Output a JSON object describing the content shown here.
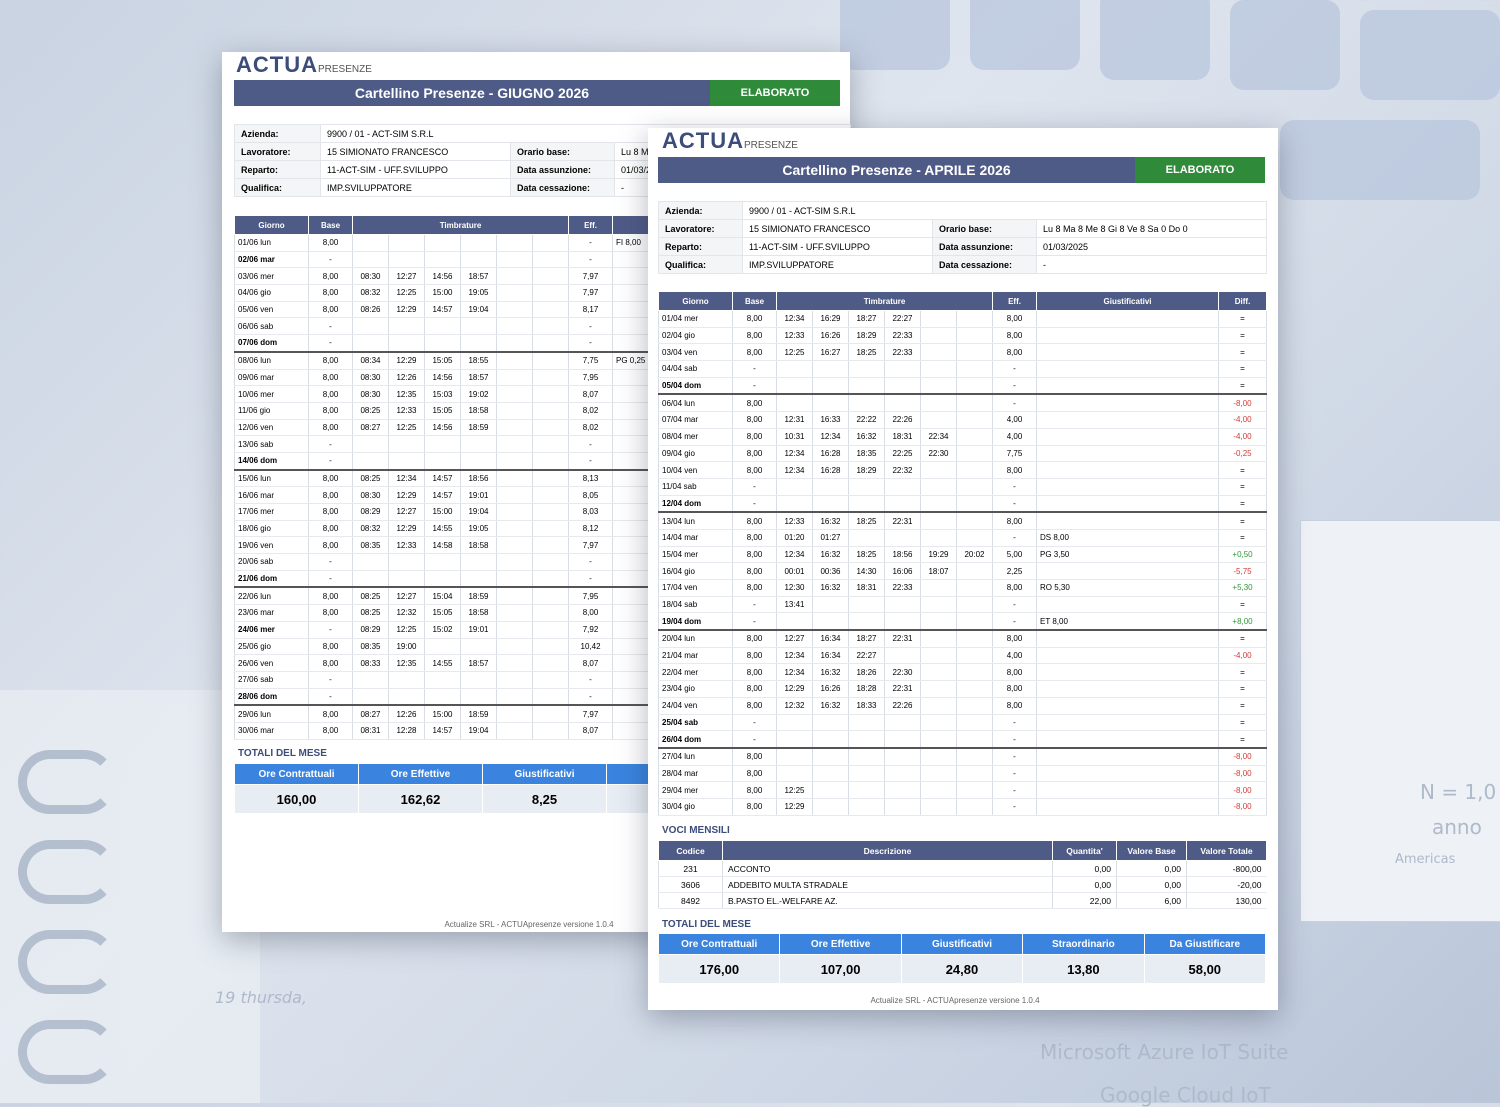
{
  "background": {
    "texts": [
      "N = 1,0",
      "anno",
      "Americas",
      "19  thursda,",
      "Microsoft Azure IoT Suite",
      "Google Cloud IoT"
    ]
  },
  "brand": {
    "main": "ACTUA",
    "sub": "PRESENZE"
  },
  "colors": {
    "header": "#4f5b87",
    "status": "#2f8b3a",
    "totals": "#3a84e0"
  },
  "info_labels": {
    "azienda": "Azienda:",
    "lavoratore": "Lavoratore:",
    "reparto": "Reparto:",
    "qualifica": "Qualifica:",
    "orario": "Orario base:",
    "assunzione": "Data assunzione:",
    "cessazione": "Data cessazione:"
  },
  "table_headers": {
    "giorno": "Giorno",
    "base": "Base",
    "timbrature": "Timbrature",
    "eff": "Eff.",
    "giust": "Giustificativi",
    "diff": "Diff."
  },
  "totals_headers": [
    "Ore Contrattuali",
    "Ore Effettive",
    "Giustificativi",
    "Straordinario",
    "Da Giustificare"
  ],
  "voci_headers": [
    "Codice",
    "Descrizione",
    "Quantita'",
    "Valore Base",
    "Valore Totale"
  ],
  "june": {
    "title": "Cartellino Presenze - GIUGNO 2026",
    "status": "ELABORATO",
    "azienda": "9900 / 01 - ACT-SIM S.R.L",
    "lavoratore": "15 SIMIONATO FRANCESCO",
    "reparto": "11-ACT-SIM - UFF.SVILUPPO",
    "qualifica": "IMP.SVILUPPATORE",
    "orario": "Lu 8 Ma",
    "assunzione": "01/03/2",
    "cessazione": "-",
    "rows": [
      {
        "d": "01/06 lun",
        "b": "8,00",
        "t": [
          "",
          "",
          "",
          "",
          "",
          ""
        ],
        "e": "-",
        "g": "FI 8,00"
      },
      {
        "d": "02/06 mar",
        "b": "-",
        "t": [
          "",
          "",
          "",
          "",
          "",
          ""
        ],
        "e": "-",
        "g": "",
        "bold": true
      },
      {
        "d": "03/06 mer",
        "b": "8,00",
        "t": [
          "08:30",
          "12:27",
          "14:56",
          "18:57",
          "",
          ""
        ],
        "e": "7,97",
        "g": ""
      },
      {
        "d": "04/06 gio",
        "b": "8,00",
        "t": [
          "08:32",
          "12:25",
          "15:00",
          "19:05",
          "",
          ""
        ],
        "e": "7,97",
        "g": ""
      },
      {
        "d": "05/06 ven",
        "b": "8,00",
        "t": [
          "08:26",
          "12:29",
          "14:57",
          "19:04",
          "",
          ""
        ],
        "e": "8,17",
        "g": ""
      },
      {
        "d": "06/06 sab",
        "b": "-",
        "t": [
          "",
          "",
          "",
          "",
          "",
          ""
        ],
        "e": "-",
        "g": ""
      },
      {
        "d": "07/06 dom",
        "b": "-",
        "t": [
          "",
          "",
          "",
          "",
          "",
          ""
        ],
        "e": "-",
        "g": "",
        "bold": true
      },
      {
        "d": "08/06 lun",
        "b": "8,00",
        "t": [
          "08:34",
          "12:29",
          "15:05",
          "18:55",
          "",
          ""
        ],
        "e": "7,75",
        "g": "PG 0,25",
        "wk": true
      },
      {
        "d": "09/06 mar",
        "b": "8,00",
        "t": [
          "08:30",
          "12:26",
          "14:56",
          "18:57",
          "",
          ""
        ],
        "e": "7,95",
        "g": ""
      },
      {
        "d": "10/06 mer",
        "b": "8,00",
        "t": [
          "08:30",
          "12:35",
          "15:03",
          "19:02",
          "",
          ""
        ],
        "e": "8,07",
        "g": ""
      },
      {
        "d": "11/06 gio",
        "b": "8,00",
        "t": [
          "08:25",
          "12:33",
          "15:05",
          "18:58",
          "",
          ""
        ],
        "e": "8,02",
        "g": ""
      },
      {
        "d": "12/06 ven",
        "b": "8,00",
        "t": [
          "08:27",
          "12:25",
          "14:56",
          "18:59",
          "",
          ""
        ],
        "e": "8,02",
        "g": ""
      },
      {
        "d": "13/06 sab",
        "b": "-",
        "t": [
          "",
          "",
          "",
          "",
          "",
          ""
        ],
        "e": "-",
        "g": ""
      },
      {
        "d": "14/06 dom",
        "b": "-",
        "t": [
          "",
          "",
          "",
          "",
          "",
          ""
        ],
        "e": "-",
        "g": "",
        "bold": true
      },
      {
        "d": "15/06 lun",
        "b": "8,00",
        "t": [
          "08:25",
          "12:34",
          "14:57",
          "18:56",
          "",
          ""
        ],
        "e": "8,13",
        "g": "",
        "wk": true
      },
      {
        "d": "16/06 mar",
        "b": "8,00",
        "t": [
          "08:30",
          "12:29",
          "14:57",
          "19:01",
          "",
          ""
        ],
        "e": "8,05",
        "g": ""
      },
      {
        "d": "17/06 mer",
        "b": "8,00",
        "t": [
          "08:29",
          "12:27",
          "15:00",
          "19:04",
          "",
          ""
        ],
        "e": "8,03",
        "g": ""
      },
      {
        "d": "18/06 gio",
        "b": "8,00",
        "t": [
          "08:32",
          "12:29",
          "14:55",
          "19:05",
          "",
          ""
        ],
        "e": "8,12",
        "g": ""
      },
      {
        "d": "19/06 ven",
        "b": "8,00",
        "t": [
          "08:35",
          "12:33",
          "14:58",
          "18:58",
          "",
          ""
        ],
        "e": "7,97",
        "g": ""
      },
      {
        "d": "20/06 sab",
        "b": "-",
        "t": [
          "",
          "",
          "",
          "",
          "",
          ""
        ],
        "e": "-",
        "g": ""
      },
      {
        "d": "21/06 dom",
        "b": "-",
        "t": [
          "",
          "",
          "",
          "",
          "",
          ""
        ],
        "e": "-",
        "g": "",
        "bold": true
      },
      {
        "d": "22/06 lun",
        "b": "8,00",
        "t": [
          "08:25",
          "12:27",
          "15:04",
          "18:59",
          "",
          ""
        ],
        "e": "7,95",
        "g": "",
        "wk": true
      },
      {
        "d": "23/06 mar",
        "b": "8,00",
        "t": [
          "08:25",
          "12:32",
          "15:05",
          "18:58",
          "",
          ""
        ],
        "e": "8,00",
        "g": ""
      },
      {
        "d": "24/06 mer",
        "b": "-",
        "t": [
          "08:29",
          "12:25",
          "15:02",
          "19:01",
          "",
          ""
        ],
        "e": "7,92",
        "g": "",
        "bold": true
      },
      {
        "d": "25/06 gio",
        "b": "8,00",
        "t": [
          "08:35",
          "19:00",
          "",
          "",
          "",
          ""
        ],
        "e": "10,42",
        "g": ""
      },
      {
        "d": "26/06 ven",
        "b": "8,00",
        "t": [
          "08:33",
          "12:35",
          "14:55",
          "18:57",
          "",
          ""
        ],
        "e": "8,07",
        "g": ""
      },
      {
        "d": "27/06 sab",
        "b": "-",
        "t": [
          "",
          "",
          "",
          "",
          "",
          ""
        ],
        "e": "-",
        "g": ""
      },
      {
        "d": "28/06 dom",
        "b": "-",
        "t": [
          "",
          "",
          "",
          "",
          "",
          ""
        ],
        "e": "-",
        "g": "",
        "bold": true
      },
      {
        "d": "29/06 lun",
        "b": "8,00",
        "t": [
          "08:27",
          "12:26",
          "15:00",
          "18:59",
          "",
          ""
        ],
        "e": "7,97",
        "g": "",
        "wk": true
      },
      {
        "d": "30/06 mar",
        "b": "8,00",
        "t": [
          "08:31",
          "12:28",
          "14:57",
          "19:04",
          "",
          ""
        ],
        "e": "8,07",
        "g": ""
      }
    ],
    "totals_title": "TOTALI DEL MESE",
    "totals_headers_visible": [
      "Ore Contrattuali",
      "Ore Effettive",
      "Giustificativi",
      "Strao"
    ],
    "totals": [
      "160,00",
      "162,62",
      "8,25",
      "1"
    ],
    "footer": "Actualize SRL - ACTUApresenze versione 1.0.4"
  },
  "april": {
    "title": "Cartellino Presenze - APRILE 2026",
    "status": "ELABORATO",
    "azienda": "9900 / 01 - ACT-SIM S.R.L",
    "lavoratore": "15 SIMIONATO FRANCESCO",
    "reparto": "11-ACT-SIM - UFF.SVILUPPO",
    "qualifica": "IMP.SVILUPPATORE",
    "orario": "Lu 8 Ma 8 Me 8 Gi 8 Ve 8 Sa 0 Do 0",
    "assunzione": "01/03/2025",
    "cessazione": "-",
    "rows": [
      {
        "d": "01/04 mer",
        "b": "8,00",
        "t": [
          "12:34",
          "16:29",
          "18:27",
          "22:27",
          "",
          ""
        ],
        "e": "8,00",
        "g": "",
        "df": "=",
        "dc": ""
      },
      {
        "d": "02/04 gio",
        "b": "8,00",
        "t": [
          "12:33",
          "16:26",
          "18:29",
          "22:33",
          "",
          ""
        ],
        "e": "8,00",
        "g": "",
        "df": "=",
        "dc": ""
      },
      {
        "d": "03/04 ven",
        "b": "8,00",
        "t": [
          "12:25",
          "16:27",
          "18:25",
          "22:33",
          "",
          ""
        ],
        "e": "8,00",
        "g": "",
        "df": "=",
        "dc": ""
      },
      {
        "d": "04/04 sab",
        "b": "-",
        "t": [
          "",
          "",
          "",
          "",
          "",
          ""
        ],
        "e": "-",
        "g": "",
        "df": "=",
        "dc": ""
      },
      {
        "d": "05/04 dom",
        "b": "-",
        "t": [
          "",
          "",
          "",
          "",
          "",
          ""
        ],
        "e": "-",
        "g": "",
        "df": "=",
        "dc": "",
        "bold": true
      },
      {
        "d": "06/04 lun",
        "b": "8,00",
        "t": [
          "",
          "",
          "",
          "",
          "",
          ""
        ],
        "e": "-",
        "g": "",
        "df": "-8,00",
        "dc": "neg",
        "wk": true
      },
      {
        "d": "07/04 mar",
        "b": "8,00",
        "t": [
          "12:31",
          "16:33",
          "22:22",
          "22:26",
          "",
          ""
        ],
        "e": "4,00",
        "g": "",
        "df": "-4,00",
        "dc": "neg"
      },
      {
        "d": "08/04 mer",
        "b": "8,00",
        "t": [
          "10:31",
          "12:34",
          "16:32",
          "18:31",
          "22:34",
          ""
        ],
        "e": "4,00",
        "g": "",
        "df": "-4,00",
        "dc": "neg"
      },
      {
        "d": "09/04 gio",
        "b": "8,00",
        "t": [
          "12:34",
          "16:28",
          "18:35",
          "22:25",
          "22:30",
          ""
        ],
        "e": "7,75",
        "g": "",
        "df": "-0,25",
        "dc": "neg"
      },
      {
        "d": "10/04 ven",
        "b": "8,00",
        "t": [
          "12:34",
          "16:28",
          "18:29",
          "22:32",
          "",
          ""
        ],
        "e": "8,00",
        "g": "",
        "df": "=",
        "dc": ""
      },
      {
        "d": "11/04 sab",
        "b": "-",
        "t": [
          "",
          "",
          "",
          "",
          "",
          ""
        ],
        "e": "-",
        "g": "",
        "df": "=",
        "dc": ""
      },
      {
        "d": "12/04 dom",
        "b": "-",
        "t": [
          "",
          "",
          "",
          "",
          "",
          ""
        ],
        "e": "-",
        "g": "",
        "df": "=",
        "dc": "",
        "bold": true
      },
      {
        "d": "13/04 lun",
        "b": "8,00",
        "t": [
          "12:33",
          "16:32",
          "18:25",
          "22:31",
          "",
          ""
        ],
        "e": "8,00",
        "g": "",
        "df": "=",
        "dc": "",
        "wk": true
      },
      {
        "d": "14/04 mar",
        "b": "8,00",
        "t": [
          "01:20",
          "01:27",
          "",
          "",
          "",
          ""
        ],
        "e": "-",
        "g": "DS 8,00",
        "df": "=",
        "dc": ""
      },
      {
        "d": "15/04 mer",
        "b": "8,00",
        "t": [
          "12:34",
          "16:32",
          "18:25",
          "18:56",
          "19:29",
          "20:02"
        ],
        "e": "5,00",
        "g": "PG 3,50",
        "df": "+0,50",
        "dc": "pos"
      },
      {
        "d": "16/04 gio",
        "b": "8,00",
        "t": [
          "00:01",
          "00:36",
          "14:30",
          "16:06",
          "18:07",
          ""
        ],
        "e": "2,25",
        "g": "",
        "df": "-5,75",
        "dc": "neg"
      },
      {
        "d": "17/04 ven",
        "b": "8,00",
        "t": [
          "12:30",
          "16:32",
          "18:31",
          "22:33",
          "",
          ""
        ],
        "e": "8,00",
        "g": "RO 5,30",
        "df": "+5,30",
        "dc": "pos"
      },
      {
        "d": "18/04 sab",
        "b": "-",
        "t": [
          "13:41",
          "",
          "",
          "",
          "",
          ""
        ],
        "e": "-",
        "g": "",
        "df": "=",
        "dc": ""
      },
      {
        "d": "19/04 dom",
        "b": "-",
        "t": [
          "",
          "",
          "",
          "",
          "",
          ""
        ],
        "e": "-",
        "g": "ET 8,00",
        "df": "+8,00",
        "dc": "pos",
        "bold": true
      },
      {
        "d": "20/04 lun",
        "b": "8,00",
        "t": [
          "12:27",
          "16:34",
          "18:27",
          "22:31",
          "",
          ""
        ],
        "e": "8,00",
        "g": "",
        "df": "=",
        "dc": "",
        "wk": true
      },
      {
        "d": "21/04 mar",
        "b": "8,00",
        "t": [
          "12:34",
          "16:34",
          "22:27",
          "",
          "",
          ""
        ],
        "e": "4,00",
        "g": "",
        "df": "-4,00",
        "dc": "neg"
      },
      {
        "d": "22/04 mer",
        "b": "8,00",
        "t": [
          "12:34",
          "16:32",
          "18:26",
          "22:30",
          "",
          ""
        ],
        "e": "8,00",
        "g": "",
        "df": "=",
        "dc": ""
      },
      {
        "d": "23/04 gio",
        "b": "8,00",
        "t": [
          "12:29",
          "16:26",
          "18:28",
          "22:31",
          "",
          ""
        ],
        "e": "8,00",
        "g": "",
        "df": "=",
        "dc": ""
      },
      {
        "d": "24/04 ven",
        "b": "8,00",
        "t": [
          "12:32",
          "16:32",
          "18:33",
          "22:26",
          "",
          ""
        ],
        "e": "8,00",
        "g": "",
        "df": "=",
        "dc": ""
      },
      {
        "d": "25/04 sab",
        "b": "-",
        "t": [
          "",
          "",
          "",
          "",
          "",
          ""
        ],
        "e": "-",
        "g": "",
        "df": "=",
        "dc": "",
        "bold": true
      },
      {
        "d": "26/04 dom",
        "b": "-",
        "t": [
          "",
          "",
          "",
          "",
          "",
          ""
        ],
        "e": "-",
        "g": "",
        "df": "=",
        "dc": "",
        "bold": true
      },
      {
        "d": "27/04 lun",
        "b": "8,00",
        "t": [
          "",
          "",
          "",
          "",
          "",
          ""
        ],
        "e": "-",
        "g": "",
        "df": "-8,00",
        "dc": "neg",
        "wk": true
      },
      {
        "d": "28/04 mar",
        "b": "8,00",
        "t": [
          "",
          "",
          "",
          "",
          "",
          ""
        ],
        "e": "-",
        "g": "",
        "df": "-8,00",
        "dc": "neg"
      },
      {
        "d": "29/04 mer",
        "b": "8,00",
        "t": [
          "12:25",
          "",
          "",
          "",
          "",
          ""
        ],
        "e": "-",
        "g": "",
        "df": "-8,00",
        "dc": "neg"
      },
      {
        "d": "30/04 gio",
        "b": "8,00",
        "t": [
          "12:29",
          "",
          "",
          "",
          "",
          ""
        ],
        "e": "-",
        "g": "",
        "df": "-8,00",
        "dc": "neg"
      }
    ],
    "voci_title": "VOCI MENSILI",
    "voci": [
      {
        "c": "231",
        "d": "ACCONTO",
        "q": "0,00",
        "vb": "0,00",
        "vt": "-800,00"
      },
      {
        "c": "3606",
        "d": "ADDEBITO MULTA STRADALE",
        "q": "0,00",
        "vb": "0,00",
        "vt": "-20,00"
      },
      {
        "c": "8492",
        "d": "B.PASTO EL.-WELFARE AZ.",
        "q": "22,00",
        "vb": "6,00",
        "vt": "130,00"
      }
    ],
    "totals_title": "TOTALI DEL MESE",
    "totals": [
      "176,00",
      "107,00",
      "24,80",
      "13,80",
      "58,00"
    ],
    "footer": "Actualize SRL - ACTUApresenze versione 1.0.4"
  }
}
